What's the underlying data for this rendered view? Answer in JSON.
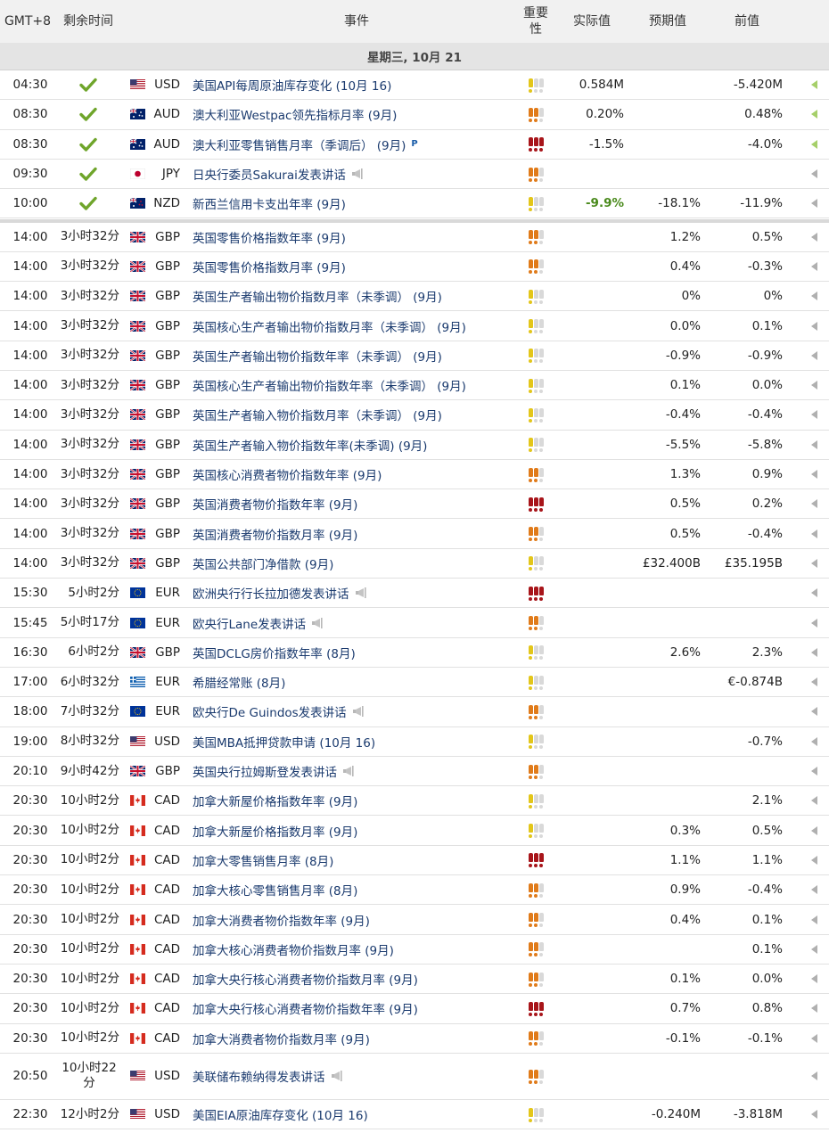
{
  "header": {
    "gmt": "GMT+8",
    "remaining": "剩余时间",
    "event": "事件",
    "importance": "重要性",
    "actual": "实际值",
    "forecast": "预期值",
    "previous": "前值"
  },
  "day_label": "星期三, 10月 21",
  "colors": {
    "imp_low": "#e3c61a",
    "imp_med": "#e07b1a",
    "imp_high": "#a8151a",
    "imp_off": "#d9d9d9",
    "green": "#4a8a1c"
  },
  "rows": [
    {
      "time": "04:30",
      "remaining": "",
      "done": true,
      "flag": "us",
      "currency": "USD",
      "event": "美国API每周原油库存变化 (10月 16)",
      "importance": 1,
      "actual": "0.584M",
      "forecast": "",
      "previous": "-5.420M",
      "arrow": "green"
    },
    {
      "time": "08:30",
      "remaining": "",
      "done": true,
      "flag": "au",
      "currency": "AUD",
      "event": "澳大利亚Westpac领先指标月率 (9月)",
      "importance": 2,
      "actual": "0.20%",
      "forecast": "",
      "previous": "0.48%",
      "arrow": "green"
    },
    {
      "time": "08:30",
      "remaining": "",
      "done": true,
      "flag": "au",
      "currency": "AUD",
      "event": "澳大利亚零售销售月率（季调后） (9月)",
      "badge": "P",
      "importance": 3,
      "actual": "-1.5%",
      "forecast": "",
      "previous": "-4.0%",
      "arrow": "green"
    },
    {
      "time": "09:30",
      "remaining": "",
      "done": true,
      "flag": "jp",
      "currency": "JPY",
      "event": "日央行委员Sakurai发表讲话",
      "speech": true,
      "importance": 2,
      "actual": "",
      "forecast": "",
      "previous": "",
      "arrow": "gray"
    },
    {
      "time": "10:00",
      "remaining": "",
      "done": true,
      "flag": "nz",
      "currency": "NZD",
      "event": "新西兰信用卡支出年率 (9月)",
      "importance": 1,
      "actual": "-9.9%",
      "actual_green": true,
      "forecast": "-18.1%",
      "previous": "-11.9%",
      "arrow": "gray"
    },
    {
      "time": "14:00",
      "remaining": "3小时32分",
      "flag": "gb",
      "currency": "GBP",
      "event": "英国零售价格指数年率 (9月)",
      "importance": 2,
      "actual": "",
      "forecast": "1.2%",
      "previous": "0.5%",
      "arrow": "gray"
    },
    {
      "time": "14:00",
      "remaining": "3小时32分",
      "flag": "gb",
      "currency": "GBP",
      "event": "英国零售价格指数月率 (9月)",
      "importance": 2,
      "actual": "",
      "forecast": "0.4%",
      "previous": "-0.3%",
      "arrow": "gray"
    },
    {
      "time": "14:00",
      "remaining": "3小时32分",
      "flag": "gb",
      "currency": "GBP",
      "event": "英国生产者输出物价指数月率（未季调） (9月)",
      "importance": 1,
      "actual": "",
      "forecast": "0%",
      "previous": "0%",
      "arrow": "gray"
    },
    {
      "time": "14:00",
      "remaining": "3小时32分",
      "flag": "gb",
      "currency": "GBP",
      "event": "英国核心生产者输出物价指数月率（未季调） (9月)",
      "importance": 1,
      "actual": "",
      "forecast": "0.0%",
      "previous": "0.1%",
      "arrow": "gray"
    },
    {
      "time": "14:00",
      "remaining": "3小时32分",
      "flag": "gb",
      "currency": "GBP",
      "event": "英国生产者输出物价指数年率（未季调） (9月)",
      "importance": 1,
      "actual": "",
      "forecast": "-0.9%",
      "previous": "-0.9%",
      "arrow": "gray"
    },
    {
      "time": "14:00",
      "remaining": "3小时32分",
      "flag": "gb",
      "currency": "GBP",
      "event": "英国核心生产者输出物价指数年率（未季调） (9月)",
      "importance": 1,
      "actual": "",
      "forecast": "0.1%",
      "previous": "0.0%",
      "arrow": "gray"
    },
    {
      "time": "14:00",
      "remaining": "3小时32分",
      "flag": "gb",
      "currency": "GBP",
      "event": "英国生产者输入物价指数月率（未季调） (9月)",
      "importance": 1,
      "actual": "",
      "forecast": "-0.4%",
      "previous": "-0.4%",
      "arrow": "gray"
    },
    {
      "time": "14:00",
      "remaining": "3小时32分",
      "flag": "gb",
      "currency": "GBP",
      "event": "英国生产者输入物价指数年率(未季调) (9月)",
      "importance": 1,
      "actual": "",
      "forecast": "-5.5%",
      "previous": "-5.8%",
      "arrow": "gray"
    },
    {
      "time": "14:00",
      "remaining": "3小时32分",
      "flag": "gb",
      "currency": "GBP",
      "event": "英国核心消费者物价指数年率 (9月)",
      "importance": 2,
      "actual": "",
      "forecast": "1.3%",
      "previous": "0.9%",
      "arrow": "gray"
    },
    {
      "time": "14:00",
      "remaining": "3小时32分",
      "flag": "gb",
      "currency": "GBP",
      "event": "英国消费者物价指数年率 (9月)",
      "importance": 3,
      "actual": "",
      "forecast": "0.5%",
      "previous": "0.2%",
      "arrow": "gray"
    },
    {
      "time": "14:00",
      "remaining": "3小时32分",
      "flag": "gb",
      "currency": "GBP",
      "event": "英国消费者物价指数月率 (9月)",
      "importance": 2,
      "actual": "",
      "forecast": "0.5%",
      "previous": "-0.4%",
      "arrow": "gray"
    },
    {
      "time": "14:00",
      "remaining": "3小时32分",
      "flag": "gb",
      "currency": "GBP",
      "event": "英国公共部门净借款 (9月)",
      "importance": 1,
      "actual": "",
      "forecast": "£32.400B",
      "previous": "£35.195B",
      "arrow": "gray"
    },
    {
      "time": "15:30",
      "remaining": "5小时2分",
      "flag": "eu",
      "currency": "EUR",
      "event": "欧洲央行行长拉加德发表讲话",
      "speech": true,
      "importance": 3,
      "actual": "",
      "forecast": "",
      "previous": "",
      "arrow": "gray"
    },
    {
      "time": "15:45",
      "remaining": "5小时17分",
      "flag": "eu",
      "currency": "EUR",
      "event": "欧央行Lane发表讲话",
      "speech": true,
      "importance": 2,
      "actual": "",
      "forecast": "",
      "previous": "",
      "arrow": "gray"
    },
    {
      "time": "16:30",
      "remaining": "6小时2分",
      "flag": "gb",
      "currency": "GBP",
      "event": "英国DCLG房价指数年率 (8月)",
      "importance": 1,
      "actual": "",
      "forecast": "2.6%",
      "previous": "2.3%",
      "arrow": "gray"
    },
    {
      "time": "17:00",
      "remaining": "6小时32分",
      "flag": "gr",
      "currency": "EUR",
      "event": "希腊经常账 (8月)",
      "importance": 1,
      "actual": "",
      "forecast": "",
      "previous": "€-0.874B",
      "arrow": "gray"
    },
    {
      "time": "18:00",
      "remaining": "7小时32分",
      "flag": "eu",
      "currency": "EUR",
      "event": "欧央行De Guindos发表讲话",
      "speech": true,
      "importance": 2,
      "actual": "",
      "forecast": "",
      "previous": "",
      "arrow": "gray"
    },
    {
      "time": "19:00",
      "remaining": "8小时32分",
      "flag": "us",
      "currency": "USD",
      "event": "美国MBA抵押贷款申请 (10月 16)",
      "importance": 1,
      "actual": "",
      "forecast": "",
      "previous": "-0.7%",
      "arrow": "gray"
    },
    {
      "time": "20:10",
      "remaining": "9小时42分",
      "flag": "gb",
      "currency": "GBP",
      "event": "英国央行拉姆斯登发表讲话",
      "speech": true,
      "importance": 2,
      "actual": "",
      "forecast": "",
      "previous": "",
      "arrow": "gray"
    },
    {
      "time": "20:30",
      "remaining": "10小时2分",
      "flag": "ca",
      "currency": "CAD",
      "event": "加拿大新屋价格指数年率 (9月)",
      "importance": 1,
      "actual": "",
      "forecast": "",
      "previous": "2.1%",
      "arrow": "gray"
    },
    {
      "time": "20:30",
      "remaining": "10小时2分",
      "flag": "ca",
      "currency": "CAD",
      "event": "加拿大新屋价格指数月率 (9月)",
      "importance": 1,
      "actual": "",
      "forecast": "0.3%",
      "previous": "0.5%",
      "arrow": "gray"
    },
    {
      "time": "20:30",
      "remaining": "10小时2分",
      "flag": "ca",
      "currency": "CAD",
      "event": "加拿大零售销售月率 (8月)",
      "importance": 3,
      "actual": "",
      "forecast": "1.1%",
      "previous": "1.1%",
      "arrow": "gray"
    },
    {
      "time": "20:30",
      "remaining": "10小时2分",
      "flag": "ca",
      "currency": "CAD",
      "event": "加拿大核心零售销售月率 (8月)",
      "importance": 2,
      "actual": "",
      "forecast": "0.9%",
      "previous": "-0.4%",
      "arrow": "gray"
    },
    {
      "time": "20:30",
      "remaining": "10小时2分",
      "flag": "ca",
      "currency": "CAD",
      "event": "加拿大消费者物价指数年率 (9月)",
      "importance": 2,
      "actual": "",
      "forecast": "0.4%",
      "previous": "0.1%",
      "arrow": "gray"
    },
    {
      "time": "20:30",
      "remaining": "10小时2分",
      "flag": "ca",
      "currency": "CAD",
      "event": "加拿大核心消费者物价指数月率 (9月)",
      "importance": 2,
      "actual": "",
      "forecast": "",
      "previous": "0.1%",
      "arrow": "gray"
    },
    {
      "time": "20:30",
      "remaining": "10小时2分",
      "flag": "ca",
      "currency": "CAD",
      "event": "加拿大央行核心消费者物价指数月率 (9月)",
      "importance": 2,
      "actual": "",
      "forecast": "0.1%",
      "previous": "0.0%",
      "arrow": "gray"
    },
    {
      "time": "20:30",
      "remaining": "10小时2分",
      "flag": "ca",
      "currency": "CAD",
      "event": "加拿大央行核心消费者物价指数年率 (9月)",
      "importance": 3,
      "actual": "",
      "forecast": "0.7%",
      "previous": "0.8%",
      "arrow": "gray"
    },
    {
      "time": "20:30",
      "remaining": "10小时2分",
      "flag": "ca",
      "currency": "CAD",
      "event": "加拿大消费者物价指数月率 (9月)",
      "importance": 2,
      "actual": "",
      "forecast": "-0.1%",
      "previous": "-0.1%",
      "arrow": "gray"
    },
    {
      "time": "20:50",
      "remaining": "10小时22分",
      "flag": "us",
      "currency": "USD",
      "event": "美联储布赖纳得发表讲话",
      "speech": true,
      "importance": 2,
      "actual": "",
      "forecast": "",
      "previous": "",
      "arrow": "gray",
      "tall": true
    },
    {
      "time": "22:30",
      "remaining": "12小时2分",
      "flag": "us",
      "currency": "USD",
      "event": "美国EIA原油库存变化 (10月 16)",
      "importance": 1,
      "actual": "",
      "forecast": "-0.240M",
      "previous": "-3.818M",
      "arrow": "gray"
    }
  ]
}
